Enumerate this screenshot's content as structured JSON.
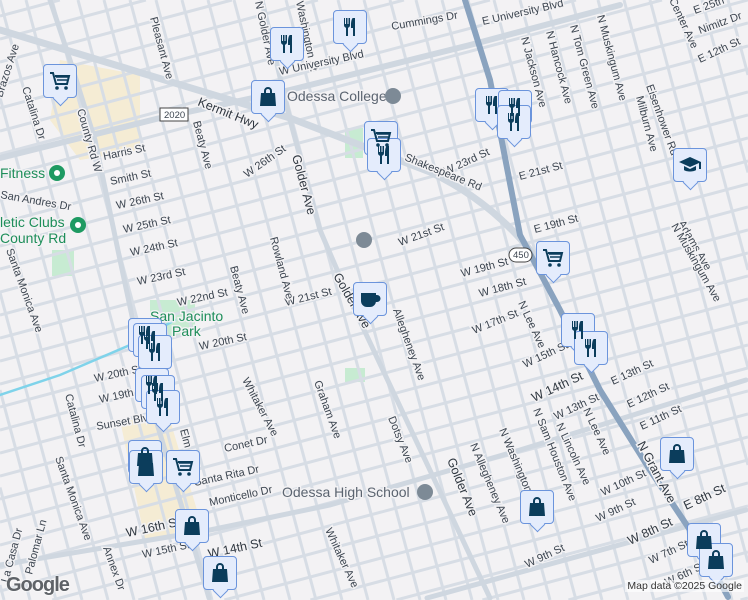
{
  "map": {
    "streets": [
      "Pleasant Ave",
      "N Golder Ave",
      "Washington St",
      "Cummings Dr",
      "W University Blvd",
      "E University Blvd",
      "N Jackson Ave",
      "N Hancock Ave",
      "N Tom Green Ave",
      "N Muskingum Ave",
      "Center Ave",
      "E 25th",
      "Nimitz Dr",
      "Brazos Ave",
      "Catalina Dr",
      "County Rd W",
      "Kermit Hwy",
      "Harris St",
      "Smith St",
      "W 26th St",
      "W 25th St",
      "W 24th St",
      "W 23rd St",
      "W 22nd St",
      "W 21st St",
      "Beaty Ave",
      "W 26th St",
      "Golder Ave",
      "Rowland Ave",
      "San Andres Dr",
      "Santa Monica Ave",
      "Eisenhower Rd",
      "Milburn Ave",
      "Adams Ave",
      "W 23rd St",
      "Shakespeare Rd",
      "E 21st St",
      "E 19th St",
      "W 21st St",
      "W 19th St",
      "W 18th St",
      "N Muskingum Ave",
      "Golder Ave",
      "Beaty Ave",
      "W 20th St",
      "W 20th St",
      "W 19th St",
      "Sunset Blvd",
      "Whitaker Ave",
      "Graham Ave",
      "Conet Dr",
      "Santa Rita Dr",
      "Monticello Dr",
      "Santa Monica Ave",
      "Palomar Ln",
      "La Casa Dr",
      "W 16th St",
      "W 15th St",
      "W 14th St",
      "Annex Dr",
      "Whitaker Ave",
      "Allegheney Ave",
      "W 17th St",
      "N Lee Ave",
      "W 15th St",
      "W 14th St",
      "E 13th St",
      "E 12th St",
      "E 11th St",
      "W 13th St",
      "N Lee Ave",
      "N Lincoln Ave",
      "N Sam Houston Ave",
      "N Washington",
      "N Allegheney Ave",
      "Dotsy Ave",
      "Golder Ave",
      "N Grant Ave",
      "W 10th St",
      "W 9th St",
      "W 8th St",
      "E 8th St",
      "W 9th St",
      "W 7th St",
      "W 6th St",
      "E 12th St",
      "Elm",
      "Catalina Dr"
    ],
    "shields": [
      "2020",
      "450"
    ],
    "places": {
      "odessa_college": "Odessa College",
      "odessa_high_school": "Odessa High School",
      "fitness": "Fitness",
      "athletic_clubs": "letic Clubs",
      "athletic_clubs_2": "County Rd",
      "san_jacinto_park_1": "San Jacinto",
      "san_jacinto_park_2": "Park"
    },
    "markers": [
      "restaurant",
      "restaurant",
      "shopping-bag",
      "shopping-cart",
      "shopping-cart",
      "restaurant",
      "restaurant",
      "restaurant",
      "restaurant",
      "school",
      "shopping-cart",
      "coffee",
      "restaurant",
      "restaurant",
      "restaurant",
      "restaurant",
      "restaurant",
      "restaurant",
      "shopping-bag",
      "shopping-bag",
      "shopping-cart",
      "shopping-bag",
      "shopping-bag",
      "shopping-bag",
      "shopping-bag",
      "shopping-bag",
      "shopping-bag",
      "restaurant",
      "restaurant"
    ],
    "colors": {
      "background": "#f3f2f4",
      "road": "#d5dce4",
      "highway": "#8aa3bf",
      "park": "#c7ebd2",
      "commercial": "#f5ecd4",
      "marker_fill": "#e4ecfc",
      "marker_border": "#6b94dc",
      "icon": "#0b3d5c"
    }
  },
  "attribution": {
    "logo": "Google",
    "text": "Map data ©2025 Google"
  }
}
